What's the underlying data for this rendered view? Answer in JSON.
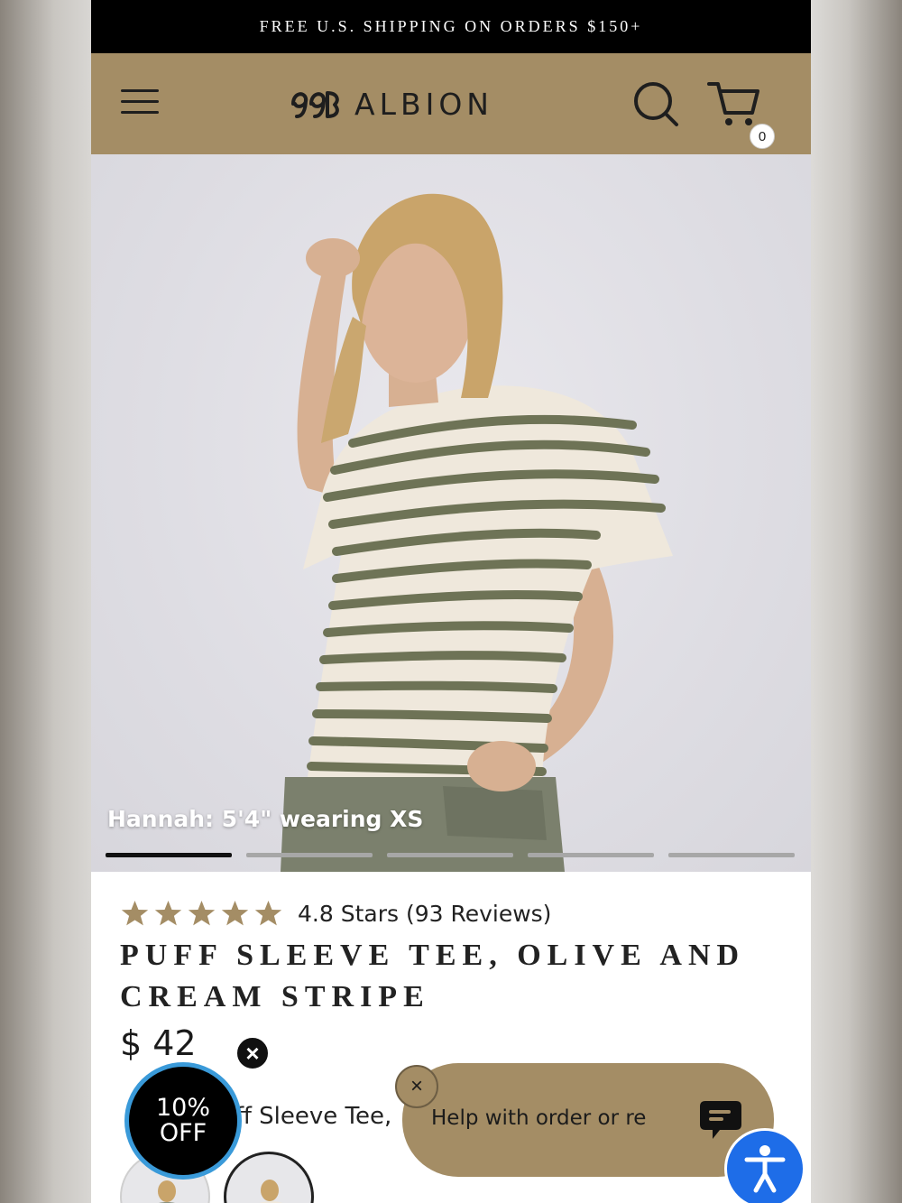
{
  "promo": {
    "text": "FREE U.S. SHIPPING ON ORDERS $150+"
  },
  "header": {
    "brand": "ALBION",
    "cart_count": "0"
  },
  "hero": {
    "caption": "Hannah: 5'4\" wearing XS",
    "slides_total": 5,
    "active_slide": 1
  },
  "product": {
    "rating_value": 4.8,
    "rating_text": "4.8 Stars (93 Reviews)",
    "title": "PUFF SLEEVE TEE, OLIVE AND CREAM STRIPE",
    "price": "$ 42",
    "color_label_visible": "ff Sleeve Tee,"
  },
  "discount": {
    "line1": "10%",
    "line2": "OFF"
  },
  "chat": {
    "text": "Help with order or re",
    "close": "×"
  },
  "colors": {
    "header_bg": "#a48d65",
    "promo_bg": "#000000",
    "star": "#a48d65",
    "accessibility": "#1e6de8",
    "badge_ring": "#3a9ad9"
  },
  "icons": [
    "menu-icon",
    "logo-mark-icon",
    "search-icon",
    "cart-icon",
    "star-icon",
    "close-icon",
    "chat-bubble-icon",
    "accessibility-icon"
  ]
}
